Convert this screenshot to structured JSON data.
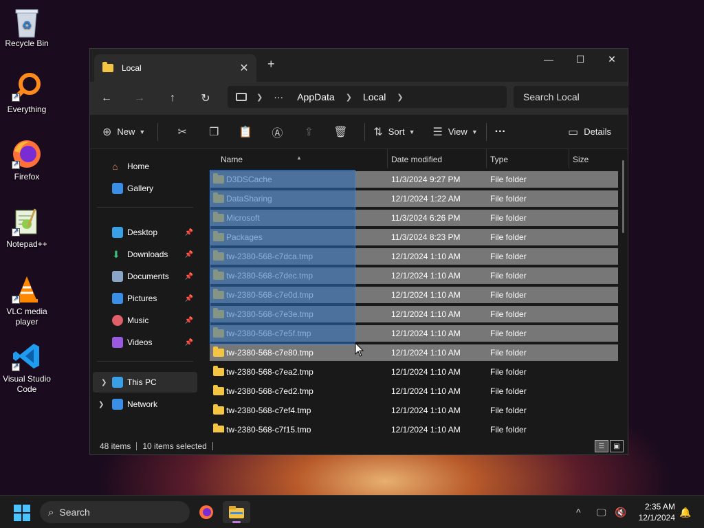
{
  "desktop": {
    "icons": [
      {
        "label": "Recycle Bin",
        "icon": "recycle-bin-icon"
      },
      {
        "label": "Everything",
        "icon": "everything-search-icon"
      },
      {
        "label": "Firefox",
        "icon": "firefox-icon"
      },
      {
        "label": "Notepad++",
        "icon": "notepad-plus-plus-icon"
      },
      {
        "label": "VLC media player",
        "icon": "vlc-icon"
      },
      {
        "label": "Visual Studio Code",
        "icon": "vscode-icon"
      }
    ]
  },
  "window": {
    "tab_title": "Local",
    "new_tab": "+",
    "close_tab": "✕",
    "controls": {
      "minimize": "—",
      "maximize": "☐",
      "close": "✕"
    },
    "nav": {
      "back": "←",
      "forward": "→",
      "up": "↑",
      "refresh": "↻"
    },
    "address": {
      "more": "···",
      "crumbs": [
        "AppData",
        "Local"
      ]
    },
    "search_placeholder": "Search Local",
    "toolbar": {
      "new": "New",
      "sort": "Sort",
      "view": "View",
      "more": "···",
      "details": "Details"
    },
    "sidebar": {
      "home": "Home",
      "gallery": "Gallery",
      "desktop": "Desktop",
      "downloads": "Downloads",
      "documents": "Documents",
      "pictures": "Pictures",
      "music": "Music",
      "videos": "Videos",
      "this_pc": "This PC",
      "network": "Network"
    },
    "columns": {
      "name": "Name",
      "date": "Date modified",
      "type": "Type",
      "size": "Size"
    },
    "files": [
      {
        "name": "D3DSCache",
        "date": "11/3/2024 9:27 PM",
        "type": "File folder",
        "selected": true
      },
      {
        "name": "DataSharing",
        "date": "12/1/2024 1:22 AM",
        "type": "File folder",
        "selected": true
      },
      {
        "name": "Microsoft",
        "date": "11/3/2024 6:26 PM",
        "type": "File folder",
        "selected": true
      },
      {
        "name": "Packages",
        "date": "11/3/2024 8:23 PM",
        "type": "File folder",
        "selected": true
      },
      {
        "name": "tw-2380-568-c7dca.tmp",
        "date": "12/1/2024 1:10 AM",
        "type": "File folder",
        "selected": true
      },
      {
        "name": "tw-2380-568-c7dec.tmp",
        "date": "12/1/2024 1:10 AM",
        "type": "File folder",
        "selected": true
      },
      {
        "name": "tw-2380-568-c7e0d.tmp",
        "date": "12/1/2024 1:10 AM",
        "type": "File folder",
        "selected": true
      },
      {
        "name": "tw-2380-568-c7e3e.tmp",
        "date": "12/1/2024 1:10 AM",
        "type": "File folder",
        "selected": true
      },
      {
        "name": "tw-2380-568-c7e5f.tmp",
        "date": "12/1/2024 1:10 AM",
        "type": "File folder",
        "selected": true
      },
      {
        "name": "tw-2380-568-c7e80.tmp",
        "date": "12/1/2024 1:10 AM",
        "type": "File folder",
        "selected": true
      },
      {
        "name": "tw-2380-568-c7ea2.tmp",
        "date": "12/1/2024 1:10 AM",
        "type": "File folder",
        "selected": false
      },
      {
        "name": "tw-2380-568-c7ed2.tmp",
        "date": "12/1/2024 1:10 AM",
        "type": "File folder",
        "selected": false
      },
      {
        "name": "tw-2380-568-c7ef4.tmp",
        "date": "12/1/2024 1:10 AM",
        "type": "File folder",
        "selected": false
      },
      {
        "name": "tw-2380-568-c7f15.tmp",
        "date": "12/1/2024 1:10 AM",
        "type": "File folder",
        "selected": false
      }
    ],
    "status": {
      "count": "48 items",
      "selected": "10 items selected"
    }
  },
  "taskbar": {
    "search": "Search",
    "time": "2:35 AM",
    "date": "12/1/2024",
    "overflow": "^"
  },
  "colors": {
    "accent": "#4cc2ff",
    "folder": "#f4c542",
    "selection": "#777777",
    "marquee": "#2a6ebe"
  }
}
